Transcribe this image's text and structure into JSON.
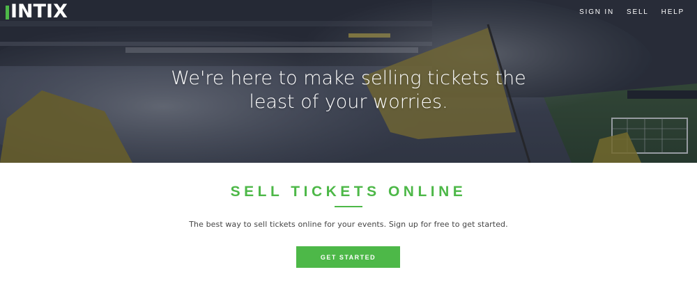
{
  "brand": {
    "logo_text": "INTIX",
    "accent_color": "#4db848"
  },
  "nav": {
    "links": [
      {
        "label": "SIGN IN"
      },
      {
        "label": "SELL"
      },
      {
        "label": "HELP"
      }
    ]
  },
  "hero": {
    "headline": "We're here to make selling tickets the least of your worries.",
    "background": "stadium-crowd-photo"
  },
  "main": {
    "title": "SELL TICKETS ONLINE",
    "description": "The best way to sell tickets online for your events. Sign up for free to get started.",
    "cta_label": "GET STARTED"
  }
}
